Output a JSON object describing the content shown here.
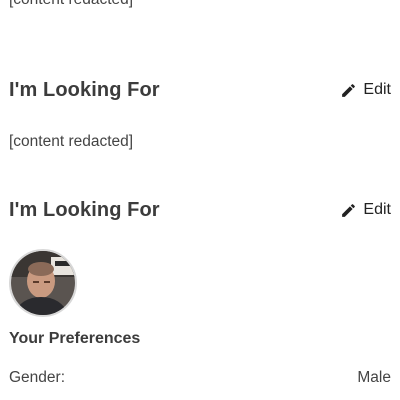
{
  "bio": {
    "text": "[content redacted]"
  },
  "sections": [
    {
      "title": "I'm Looking For",
      "edit_label": "Edit",
      "text": "[content redacted]"
    },
    {
      "title": "I'm Looking For",
      "edit_label": "Edit"
    }
  ],
  "preferences": {
    "title": "Your Preferences",
    "rows": [
      {
        "label": "Gender:",
        "value": "Male"
      }
    ]
  },
  "icons": {
    "edit": "pencil-icon"
  },
  "colors": {
    "text": "#444444",
    "heading": "#3c3c3c",
    "avatar_border": "#d8d8d8"
  }
}
